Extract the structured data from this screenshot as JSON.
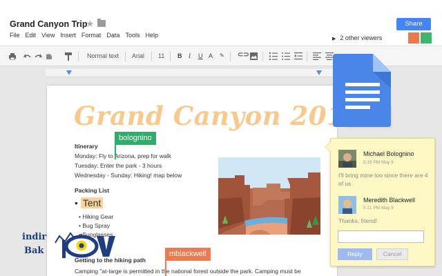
{
  "header": {
    "title": "Grand Canyon Trip",
    "menu": [
      "File",
      "Edit",
      "View",
      "Insert",
      "Format",
      "Data",
      "Tools",
      "Help"
    ],
    "share_label": "Share",
    "viewers_text": "2 other viewers",
    "viewer_colors": [
      "#ea7a4c",
      "#3bb66a"
    ]
  },
  "toolbar": {
    "style_value": "Normal text",
    "font_value": "Arial",
    "size_value": "11"
  },
  "document": {
    "heading": "Grand Canyon 2013",
    "itinerary_title": "Itinerary",
    "itinerary_lines": [
      "Monday: Fly to Arizona, prep for walk",
      "Tuesday: Enter the park - 3 hours",
      "Wednesday - Sunday: Hiking!  map below"
    ],
    "packing_title": "Packing List",
    "packing_items": [
      "Tent",
      "Hiking Gear",
      "Bug Spray",
      "Sunglasses"
    ],
    "hiking_title": "Getting to the hiking path",
    "hiking_text": "Camping \"at-large is permitted in the national forest outside the park. Camping must be"
  },
  "collaborators": [
    {
      "name": "bolognino",
      "color": "#2fae6b"
    },
    {
      "name": "mblackwell",
      "color": "#ef7a4f"
    }
  ],
  "comments": [
    {
      "author": "Michael Bolognino",
      "date": "5:19 PM May 9",
      "text": "I'll bring mine too since there are 4 of us"
    },
    {
      "author": "Meredith Blackwell",
      "date": "5:21 PM May 9",
      "text": "Thanks, friend!"
    }
  ],
  "comment_actions": {
    "reply": "Reply",
    "cancel": "Cancel"
  },
  "watermark": {
    "line1": "indir",
    "line2": "Bak"
  },
  "colors": {
    "accent": "#4285f4",
    "comment_bg": "#fdf8c4",
    "title_color": "#f8c98d"
  }
}
